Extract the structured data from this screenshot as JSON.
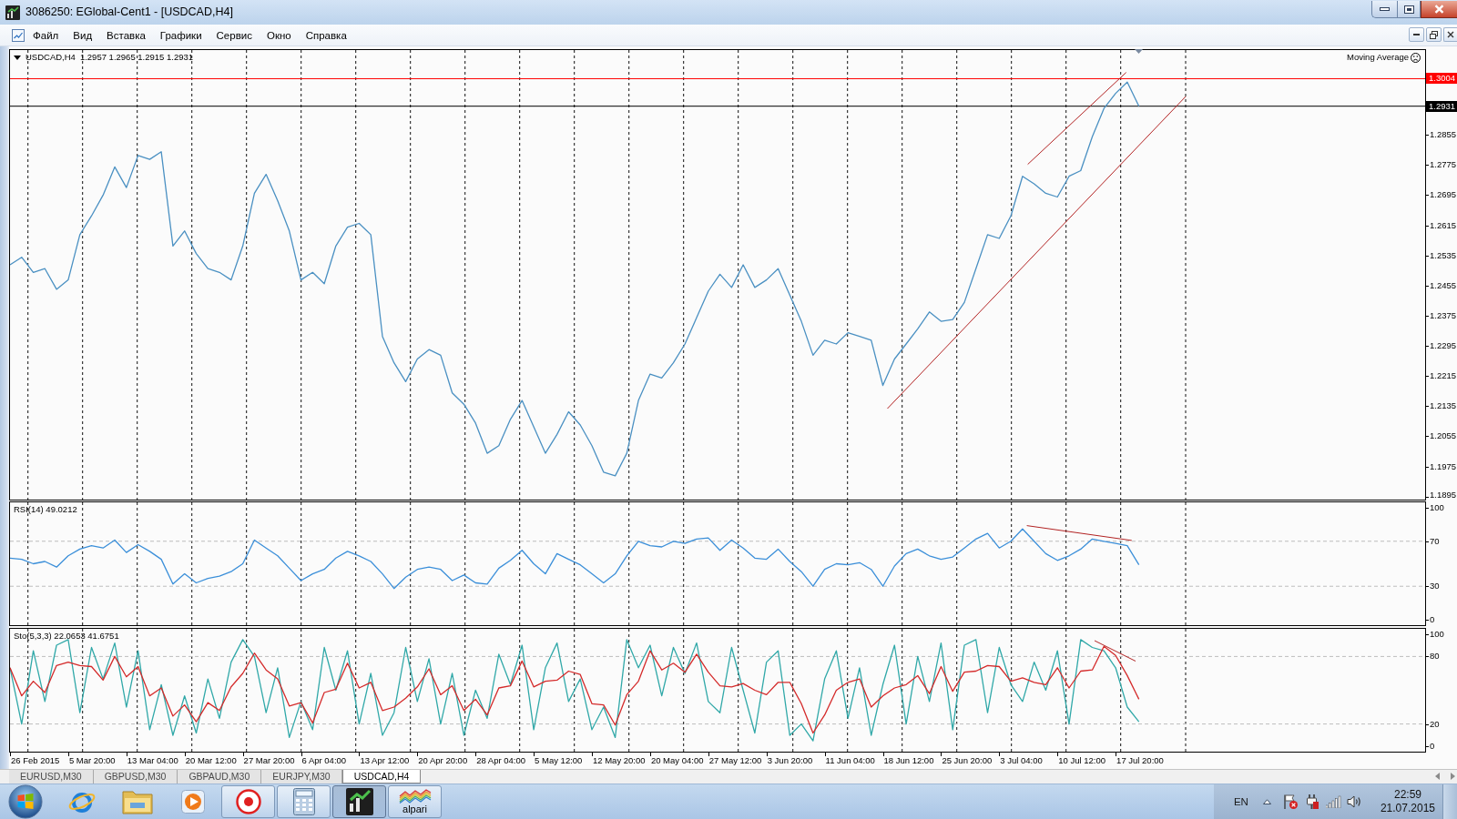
{
  "window": {
    "title": "3086250: EGlobal-Cent1 - [USDCAD,H4]"
  },
  "menu": [
    "Файл",
    "Вид",
    "Вставка",
    "Графики",
    "Сервис",
    "Окно",
    "Справка"
  ],
  "main_pane": {
    "ohlc": "1.2957 1.2965 1.2915 1.2931",
    "indicator": "Moving Average",
    "chart_data": {
      "type": "line",
      "title": "USDCAD,H4",
      "grid": true,
      "ylim": [
        1.1887,
        1.308
      ],
      "yticks": [
        1.2855,
        1.2775,
        1.2695,
        1.2615,
        1.2535,
        1.2455,
        1.2375,
        1.2295,
        1.2215,
        1.2135,
        1.2055,
        1.1975,
        1.1895
      ],
      "series": [
        {
          "color": "#4a90c2",
          "values": [
            1.251,
            1.253,
            1.249,
            1.25,
            1.2445,
            1.247,
            1.259,
            1.264,
            1.2695,
            1.277,
            1.2715,
            1.28,
            1.279,
            1.281,
            1.256,
            1.26,
            1.254,
            1.25,
            1.249,
            1.247,
            1.256,
            1.27,
            1.275,
            1.268,
            1.26,
            1.247,
            1.249,
            1.246,
            1.256,
            1.261,
            1.262,
            1.259,
            1.232,
            1.225,
            1.22,
            1.226,
            1.2285,
            1.227,
            1.217,
            1.214,
            1.209,
            1.201,
            1.203,
            1.21,
            1.215,
            1.208,
            1.201,
            1.206,
            1.212,
            1.2085,
            1.203,
            1.196,
            1.195,
            1.201,
            1.215,
            1.222,
            1.221,
            1.225,
            1.23,
            1.237,
            1.244,
            1.2485,
            1.245,
            1.251,
            1.245,
            1.247,
            1.25,
            1.243,
            1.236,
            1.227,
            1.231,
            1.23,
            1.233,
            1.232,
            1.231,
            1.219,
            1.226,
            1.23,
            1.234,
            1.2385,
            1.236,
            1.2365,
            1.241,
            1.25,
            1.259,
            1.258,
            1.264,
            1.2745,
            1.2725,
            1.27,
            1.269,
            1.2745,
            1.276,
            1.285,
            1.2925,
            1.2965,
            1.2995,
            1.2931
          ]
        }
      ],
      "ref_lines": [
        {
          "axis": "y",
          "value": 1.3004,
          "label": "1.3004",
          "color": "#ff0000"
        },
        {
          "axis": "y",
          "value": 1.2931,
          "label": "1.2931",
          "color": "#000000"
        }
      ]
    }
  },
  "rsi_pane": {
    "chart_data": {
      "type": "line",
      "title": "RSI(14) 49.0212",
      "grid": true,
      "ylim": [
        -4.6,
        104.6
      ],
      "yticks": [
        100,
        70,
        30,
        0
      ],
      "series": [
        {
          "color": "#3b8fd9",
          "values": [
            55,
            54,
            50,
            52,
            47,
            57,
            63,
            66,
            64,
            71,
            60,
            67,
            61,
            54,
            32,
            41,
            33,
            37,
            39,
            43,
            50,
            71,
            64,
            57,
            46,
            35,
            41,
            45,
            55,
            61,
            57,
            52,
            41,
            28,
            38,
            45,
            47,
            45,
            35,
            40,
            33,
            32,
            46,
            53,
            62,
            50,
            41,
            59,
            54,
            49,
            41,
            33,
            41,
            57,
            70,
            66,
            65,
            70,
            68,
            72,
            73,
            62,
            71,
            64,
            55,
            54,
            63,
            52,
            43,
            30,
            45,
            50,
            49,
            51,
            45,
            30,
            48,
            59,
            63,
            57,
            54,
            56,
            64,
            72,
            77,
            64,
            70,
            81,
            70,
            59,
            53,
            57,
            63,
            72,
            70,
            68,
            66,
            49
          ]
        }
      ]
    }
  },
  "stochastic_pane": {
    "chart_data": {
      "type": "line",
      "title": "Sto(5,3,3) 22.0653 41.6751",
      "grid": true,
      "ylim": [
        -4.6,
        104.6
      ],
      "yticks": [
        100,
        80,
        20,
        0
      ],
      "series": [
        {
          "color": "#30a8a8",
          "values": [
            70,
            20,
            85,
            40,
            90,
            95,
            30,
            88,
            60,
            92,
            35,
            85,
            15,
            55,
            10,
            45,
            12,
            60,
            25,
            75,
            95,
            80,
            30,
            70,
            8,
            40,
            15,
            88,
            50,
            85,
            20,
            65,
            10,
            30,
            88,
            40,
            78,
            20,
            65,
            10,
            50,
            25,
            82,
            55,
            90,
            15,
            70,
            92,
            40,
            60,
            15,
            35,
            8,
            95,
            70,
            90,
            45,
            88,
            65,
            92,
            40,
            30,
            88,
            50,
            12,
            75,
            85,
            10,
            20,
            5,
            60,
            85,
            25,
            70,
            10,
            55,
            90,
            20,
            80,
            40,
            92,
            15,
            90,
            95,
            30,
            88,
            55,
            40,
            75,
            50,
            85,
            20,
            95,
            88,
            85,
            70,
            35,
            22
          ]
        },
        {
          "color": "#d42a2a",
          "values": [
            70,
            45,
            58,
            48,
            72,
            75,
            72,
            71,
            59,
            80,
            62,
            71,
            45,
            52,
            27,
            37,
            22,
            39,
            32,
            53,
            65,
            83,
            68,
            60,
            36,
            39,
            21,
            48,
            51,
            74,
            52,
            57,
            32,
            35,
            43,
            53,
            69,
            46,
            54,
            32,
            42,
            28,
            52,
            54,
            76,
            53,
            58,
            59,
            67,
            64,
            38,
            37,
            19,
            46,
            58,
            85,
            68,
            74,
            66,
            82,
            66,
            54,
            53,
            56,
            50,
            46,
            57,
            57,
            38,
            12,
            28,
            50,
            57,
            60,
            35,
            45,
            52,
            55,
            63,
            47,
            71,
            49,
            66,
            67,
            72,
            71,
            58,
            61,
            57,
            55,
            70,
            52,
            67,
            68,
            89,
            81,
            63,
            42
          ]
        }
      ]
    }
  },
  "time_axis": [
    "26 Feb 2015",
    "5 Mar 20:00",
    "13 Mar 04:00",
    "20 Mar 12:00",
    "27 Mar 20:00",
    "6 Apr 04:00",
    "13 Apr 12:00",
    "20 Apr 20:00",
    "28 Apr 04:00",
    "5 May 12:00",
    "12 May 20:00",
    "20 May 04:00",
    "27 May 12:00",
    "3 Jun 20:00",
    "11 Jun 04:00",
    "18 Jun 12:00",
    "25 Jun 20:00",
    "3 Jul 04:00",
    "10 Jul 12:00",
    "17 Jul 20:00"
  ],
  "chart_tabs": [
    {
      "label": "EURUSD,M30",
      "selected": false
    },
    {
      "label": "GBPUSD,M30",
      "selected": false
    },
    {
      "label": "GBPAUD,M30",
      "selected": false
    },
    {
      "label": "EURJPY,M30",
      "selected": false
    },
    {
      "label": "USDCAD,H4",
      "selected": true
    }
  ],
  "taskbar": {
    "buttons": [
      {
        "open": false,
        "selected": false
      },
      {
        "open": false,
        "selected": false
      },
      {
        "open": false,
        "selected": false
      },
      {
        "open": true,
        "selected": false
      },
      {
        "open": true,
        "selected": false
      },
      {
        "open": true,
        "selected": true
      },
      {
        "open": true,
        "selected": false,
        "label": "alpari"
      }
    ],
    "language": "EN",
    "time": "22:59",
    "date": "21.07.2015"
  }
}
